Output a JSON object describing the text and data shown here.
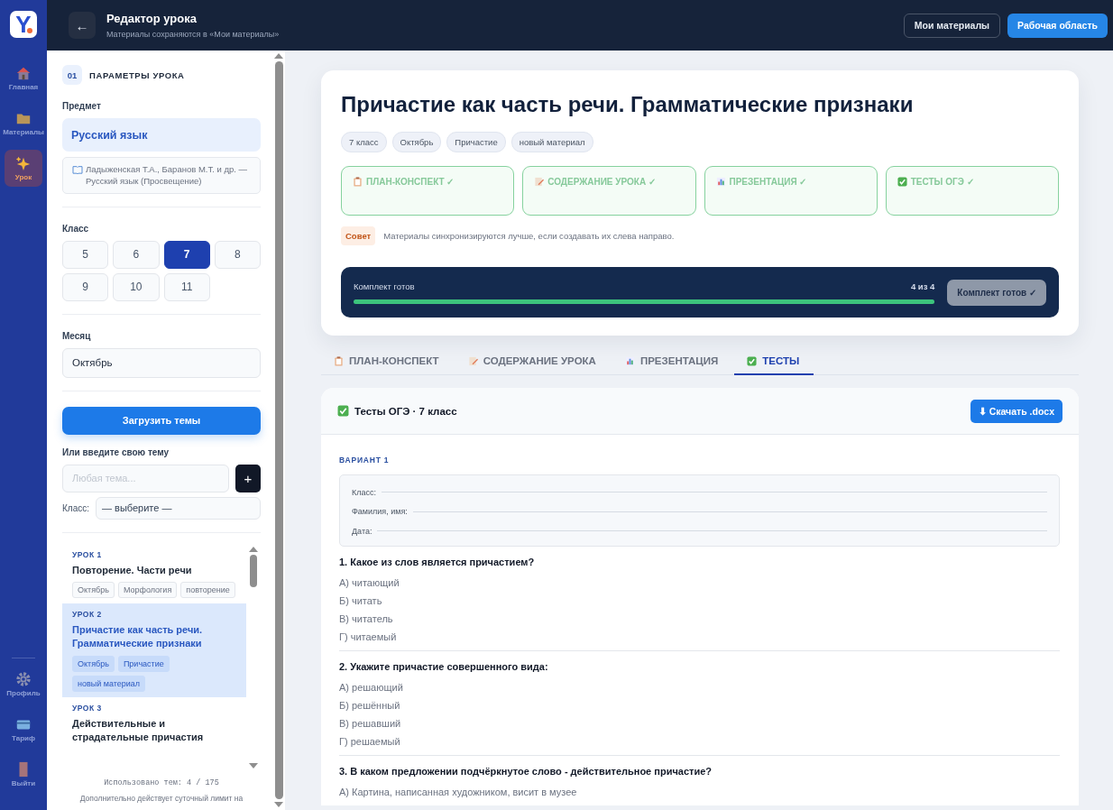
{
  "nav": [
    {
      "label": "Главная",
      "selected": false
    },
    {
      "label": "Материалы",
      "selected": false
    },
    {
      "label": "Урок",
      "selected": true
    }
  ],
  "nav_bottom": [
    {
      "label": "Профиль"
    },
    {
      "label": "Тариф"
    },
    {
      "label": "Выйти"
    }
  ],
  "logo": "Y",
  "header": {
    "back": "←",
    "title": "Редактор урока",
    "subtitle": "Материалы сохраняются в «Мои материалы»"
  },
  "header_buttons": [
    {
      "label": "Мои материалы",
      "kind": "outline"
    },
    {
      "label": "Рабочая область",
      "kind": "primary"
    }
  ],
  "params": {
    "number": "01",
    "title": "ПАРАМЕТРЫ УРОКА",
    "subject_label": "Предмет",
    "subject": "Русский язык",
    "textbook": "Ладыженская Т.А., Баранов М.Т. и др. — Русский язык (Просвещение)",
    "class_label": "Класс",
    "classes": [
      {
        "label": "5",
        "selected": false
      },
      {
        "label": "6",
        "selected": false
      },
      {
        "label": "7",
        "selected": true
      },
      {
        "label": "8",
        "selected": false
      },
      {
        "label": "9",
        "selected": false
      },
      {
        "label": "10",
        "selected": false
      },
      {
        "label": "11",
        "selected": false
      }
    ],
    "month_label": "Месяц",
    "month": "Октябрь",
    "load_button": "Загрузить темы",
    "custom_label": "Или введите свою тему",
    "topic_placeholder": "Любая тема...",
    "add_button": "+",
    "class_select_label": "Класс:",
    "class_select": "— выберите —"
  },
  "lessons": [
    {
      "number": "УРОК 1",
      "title": "Повторение. Части речи",
      "tags": [
        "Октябрь",
        "Морфология",
        "повторение"
      ],
      "selected": false
    },
    {
      "number": "УРОК 2",
      "title": "Причастие как часть речи. Грамматические признаки",
      "tags": [
        "Октябрь",
        "Причастие",
        "новый материал"
      ],
      "selected": true
    },
    {
      "number": "УРОК 3",
      "title": "Действительные и страдательные причастия",
      "selected": false
    }
  ],
  "usage": "Использовано тем: 4 / 175",
  "note": "Дополнительно действует суточный лимит на",
  "lesson": {
    "title": "Причастие как часть речи. Грамматические признаки",
    "tags": [
      "7 класс",
      "Октябрь",
      "Причастие",
      "новый материал"
    ]
  },
  "materials": [
    {
      "label": "ПЛАН-КОНСПЕКТ ✓",
      "done": true
    },
    {
      "label": "СОДЕРЖАНИЕ УРОКА ✓",
      "done": true
    },
    {
      "label": "ПРЕЗЕНТАЦИЯ ✓",
      "done": true
    },
    {
      "label": "ТЕСТЫ ОГЭ ✓",
      "done": true
    }
  ],
  "tip": {
    "badge": "Совет",
    "text": "Материалы синхронизируются лучше, если создавать их слева направо."
  },
  "progress": {
    "label": "Комплект готов",
    "count": "4 из 4",
    "level": 1,
    "button": "Комплект готов ✓"
  },
  "tabs": [
    {
      "label": "ПЛАН-КОНСПЕКТ",
      "selected": false
    },
    {
      "label": "СОДЕРЖАНИЕ УРОКА",
      "selected": false
    },
    {
      "label": "ПРЕЗЕНТАЦИЯ",
      "selected": false
    },
    {
      "label": "ТЕСТЫ",
      "selected": true
    }
  ],
  "tests": {
    "title": "Тесты ОГЭ · 7 класс",
    "download": "⬇ Скачать .docx",
    "variant": "ВАРИАНТ 1",
    "fields": [
      "Класс:",
      "Фамилия, имя:",
      "Дата:"
    ],
    "questions": [
      {
        "text": "1. Какое из слов является причастием?",
        "options": [
          "А) читающий",
          "Б) читать",
          "В) читатель",
          "Г) читаемый"
        ]
      },
      {
        "text": "2. Укажите причастие совершенного вида:",
        "options": [
          "А) решающий",
          "Б) решённый",
          "В) решавший",
          "Г) решаемый"
        ]
      },
      {
        "text": "3. В каком предложении подчёркнутое слово - действительное причастие?",
        "options": [
          "А) Картина, написанная художником, висит в музее"
        ]
      }
    ]
  }
}
